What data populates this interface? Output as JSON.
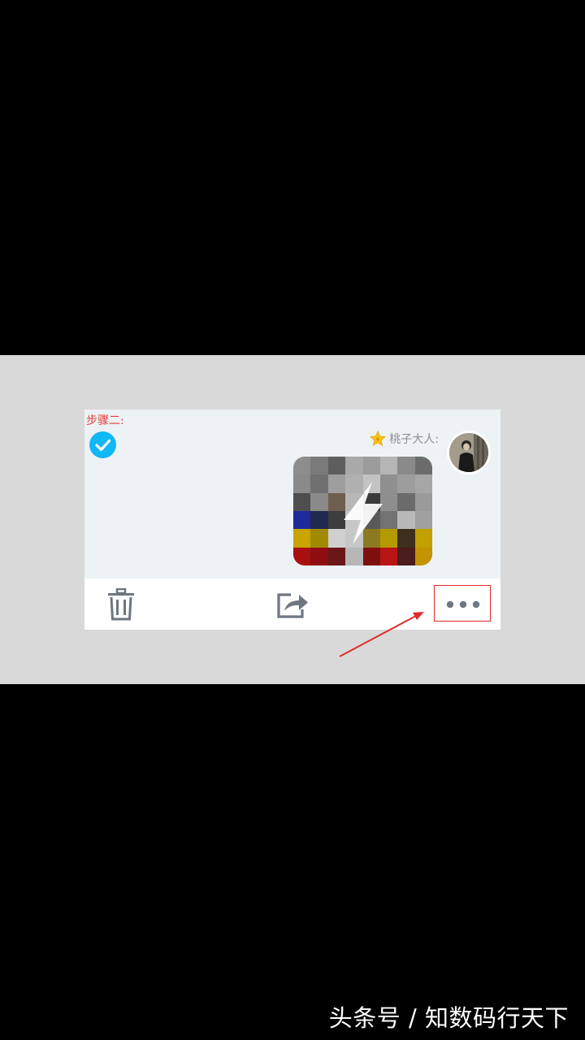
{
  "annotation": {
    "step_label": "步骤二:",
    "highlight_color": "#e02b2b"
  },
  "message": {
    "selected": true,
    "sender_badge_icon": "star-badge-icon",
    "sender_name": "桃子大人:",
    "content_type": "image-flash",
    "content_icon": "lightning-icon"
  },
  "toolbar": {
    "delete_icon": "trash-icon",
    "forward_icon": "share-icon",
    "more_icon": "more-dots-icon"
  },
  "colors": {
    "accent": "#12b7f5",
    "chat_background": "#edf2f5",
    "icon_gray": "#6e7680"
  },
  "watermark": {
    "text": "头条号 / 知数码行天下"
  }
}
